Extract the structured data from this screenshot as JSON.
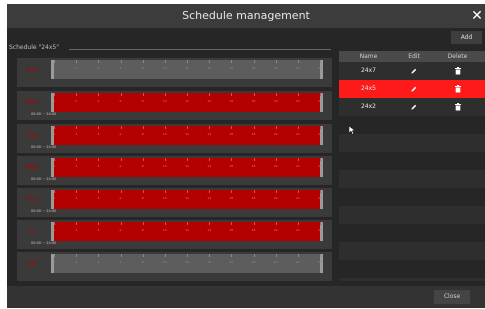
{
  "dialog": {
    "title": "Schedule management",
    "close_icon": "close-x-icon",
    "add_label": "Add",
    "close_label": "Close"
  },
  "schedule": {
    "label": "Schedule \"24x5\"",
    "hours": [
      "0",
      "2",
      "4",
      "6",
      "8",
      "10",
      "12",
      "14",
      "16",
      "18",
      "20",
      "22",
      "24"
    ],
    "days": [
      {
        "day": "Sun",
        "active": false,
        "range": ""
      },
      {
        "day": "Mon",
        "active": true,
        "range": "00:00 ~ 24:00"
      },
      {
        "day": "Tue",
        "active": true,
        "range": "00:00 ~ 24:00"
      },
      {
        "day": "Wed",
        "active": true,
        "range": "00:00 ~ 24:00"
      },
      {
        "day": "Thu",
        "active": true,
        "range": "00:00 ~ 24:00"
      },
      {
        "day": "Fri",
        "active": true,
        "range": "00:00 ~ 24:00"
      },
      {
        "day": "Sat",
        "active": false,
        "range": ""
      }
    ]
  },
  "table": {
    "headers": {
      "name": "Name",
      "edit": "Edit",
      "delete": "Delete"
    },
    "rows": [
      {
        "name": "24x7",
        "selected": false
      },
      {
        "name": "24x5",
        "selected": true
      },
      {
        "name": "24x2",
        "selected": false
      }
    ],
    "edit_icon": "pencil-icon",
    "delete_icon": "trash-icon"
  },
  "colors": {
    "schedule_fill": "#b40000",
    "selected_row": "#ff1a1a",
    "day_label": "#b00000"
  }
}
